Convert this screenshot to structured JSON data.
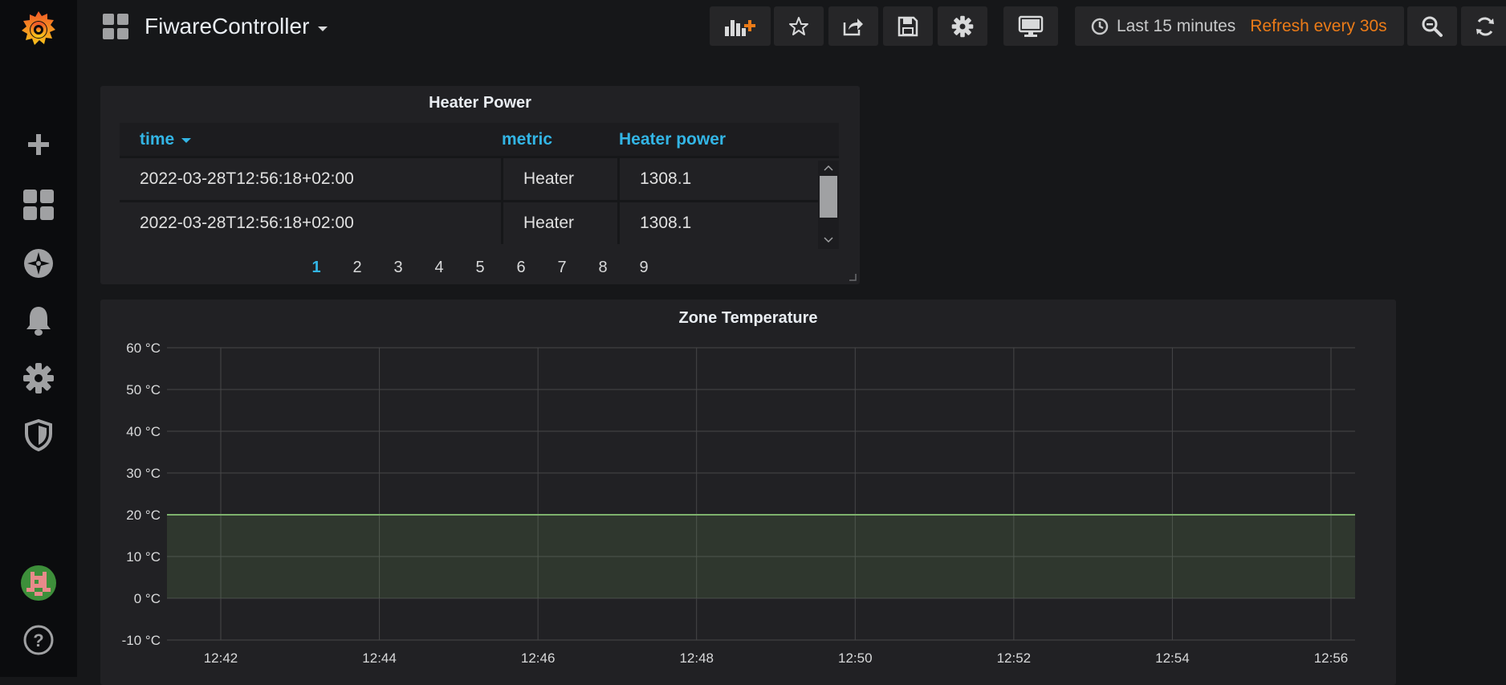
{
  "sidebar": {
    "items": [
      {
        "name": "create",
        "icon": "plus-icon"
      },
      {
        "name": "dashboards",
        "icon": "grid-icon"
      },
      {
        "name": "explore",
        "icon": "compass-icon"
      },
      {
        "name": "alerting",
        "icon": "bell-icon"
      },
      {
        "name": "configuration",
        "icon": "gear-icon"
      },
      {
        "name": "server-admin",
        "icon": "shield-icon"
      },
      {
        "name": "profile",
        "icon": "avatar-icon"
      },
      {
        "name": "help",
        "icon": "help-icon"
      }
    ]
  },
  "header": {
    "title": "FiwareController",
    "time_range": "Last 15 minutes",
    "refresh": "Refresh every 30s"
  },
  "table_panel": {
    "title": "Heater Power",
    "columns": [
      "time",
      "metric",
      "Heater power"
    ],
    "rows": [
      [
        "2022-03-28T12:56:18+02:00",
        "Heater",
        "1308.1"
      ],
      [
        "2022-03-28T12:56:18+02:00",
        "Heater",
        "1308.1"
      ]
    ],
    "pages": [
      "1",
      "2",
      "3",
      "4",
      "5",
      "6",
      "7",
      "8",
      "9"
    ],
    "active_page": "1"
  },
  "chart_panel": {
    "title": "Zone Temperature"
  },
  "chart_data": {
    "type": "area",
    "title": "Zone Temperature",
    "x_ticks": [
      "12:42",
      "12:44",
      "12:46",
      "12:48",
      "12:50",
      "12:52",
      "12:54",
      "12:56"
    ],
    "y_ticks": [
      "60 °C",
      "50 °C",
      "40 °C",
      "30 °C",
      "20 °C",
      "10 °C",
      "0 °C",
      "-10 °C"
    ],
    "ylim": [
      -10,
      60
    ],
    "grid": true,
    "series": [
      {
        "color": "#7eb26d",
        "values": [
          20,
          20,
          20,
          20,
          20,
          20,
          20,
          20
        ]
      }
    ]
  },
  "colors": {
    "accent": "#33b5e5",
    "refresh": "#eb7b18",
    "series": "#7eb26d"
  }
}
